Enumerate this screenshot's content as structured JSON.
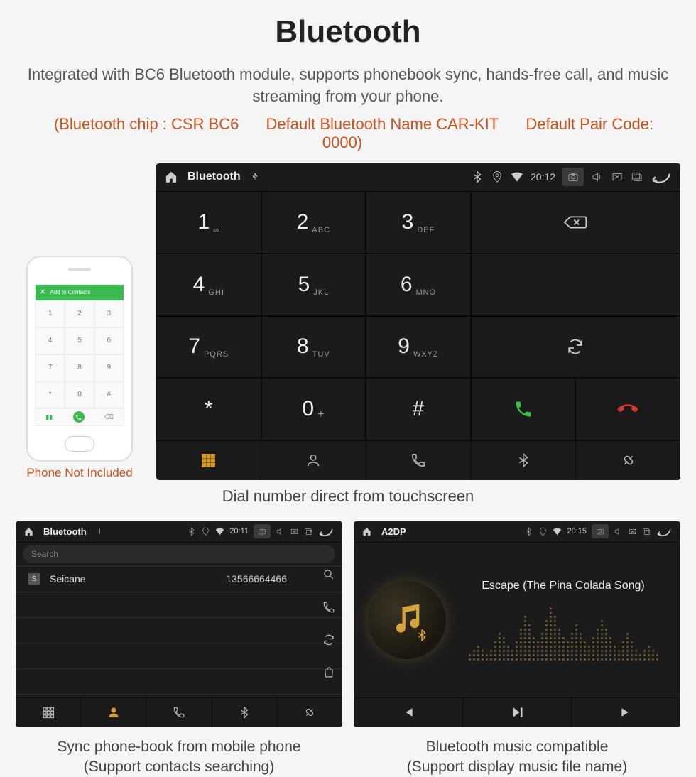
{
  "header": {
    "title": "Bluetooth",
    "description": "Integrated with BC6 Bluetooth module, supports phonebook sync, hands-free call, and music streaming from your phone.",
    "specs": {
      "chip": "(Bluetooth chip : CSR BC6",
      "name": "Default Bluetooth Name CAR-KIT",
      "pair": "Default Pair Code: 0000)"
    }
  },
  "phone_mock": {
    "header_text": "Add to Contacts",
    "keys": [
      "1",
      "2",
      "3",
      "4",
      "5",
      "6",
      "7",
      "8",
      "9",
      "*",
      "0",
      "#"
    ],
    "label": "Phone Not Included"
  },
  "dialer": {
    "statusbar": {
      "title": "Bluetooth",
      "time": "20:12"
    },
    "keys": [
      {
        "main": "1",
        "sub": "∞"
      },
      {
        "main": "2",
        "sub": "ABC"
      },
      {
        "main": "3",
        "sub": "DEF"
      },
      {
        "main": "4",
        "sub": "GHI"
      },
      {
        "main": "5",
        "sub": "JKL"
      },
      {
        "main": "6",
        "sub": "MNO"
      },
      {
        "main": "7",
        "sub": "PQRS"
      },
      {
        "main": "8",
        "sub": "TUV"
      },
      {
        "main": "9",
        "sub": "WXYZ"
      },
      {
        "main": "*",
        "sub": ""
      },
      {
        "main": "0",
        "sub": "+",
        "sup": true
      },
      {
        "main": "#",
        "sub": ""
      }
    ],
    "caption": "Dial number direct from touchscreen"
  },
  "phonebook": {
    "statusbar": {
      "title": "Bluetooth",
      "time": "20:11"
    },
    "search_placeholder": "Search",
    "contacts": [
      {
        "tag": "S",
        "name": "Seicane",
        "phone": "13566664466"
      }
    ],
    "caption_line1": "Sync phone-book from mobile phone",
    "caption_line2": "(Support contacts searching)"
  },
  "music": {
    "statusbar": {
      "title": "A2DP",
      "time": "20:15"
    },
    "song_title": "Escape (The Pina Colada Song)",
    "caption_line1": "Bluetooth music compatible",
    "caption_line2": "(Support display music file name)"
  }
}
